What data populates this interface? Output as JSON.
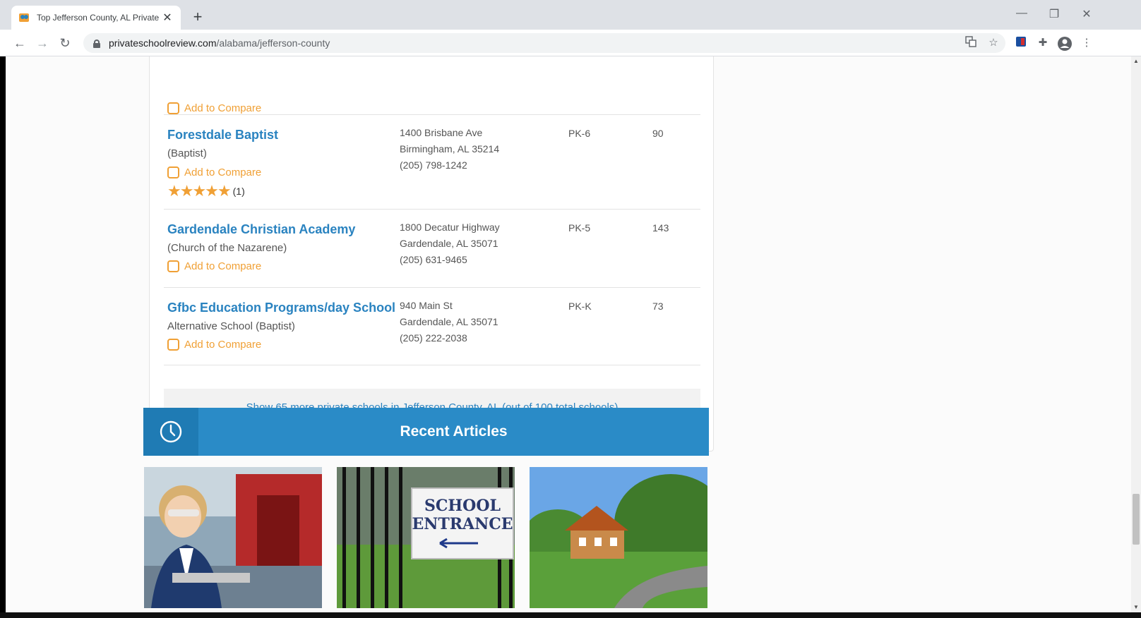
{
  "browser": {
    "tab_title": "Top Jefferson County, AL Private",
    "url_domain": "privateschoolreview.com",
    "url_path": "/alabama/jefferson-county"
  },
  "schools": [
    {
      "name": "Forestdale Baptist",
      "affiliation": "(Baptist)",
      "compare_label": "Add to Compare",
      "rating_stars": "★★★★★",
      "rating_count": "(1)",
      "address_line1": "1400 Brisbane Ave",
      "address_line2": "Birmingham, AL 35214",
      "phone": "(205) 798-1242",
      "grades": "PK-6",
      "students": "90"
    },
    {
      "name": "Gardendale Christian Academy",
      "affiliation": "(Church of the Nazarene)",
      "compare_label": "Add to Compare",
      "address_line1": "1800 Decatur Highway",
      "address_line2": "Gardendale, AL 35071",
      "phone": "(205) 631-9465",
      "grades": "PK-5",
      "students": "143"
    },
    {
      "name": "Gfbc Education Programs/day School",
      "affiliation": "Alternative School (Baptist)",
      "compare_label": "Add to Compare",
      "address_line1": "940 Main St",
      "address_line2": "Gardendale, AL 35071",
      "phone": "(205) 222-2038",
      "grades": "PK-K",
      "students": "73"
    }
  ],
  "partial_row": {
    "compare_label": "Add to Compare"
  },
  "more_link": "Show 65 more private schools in Jefferson County, AL (out of 100 total schools)",
  "articles": {
    "title": "Recent Articles",
    "sign_line1": "SCHOOL",
    "sign_line2": "ENTRANCE"
  },
  "colors": {
    "link_blue": "#2a83c0",
    "accent_orange": "#f0a035",
    "header_blue": "#2a8bc7"
  }
}
